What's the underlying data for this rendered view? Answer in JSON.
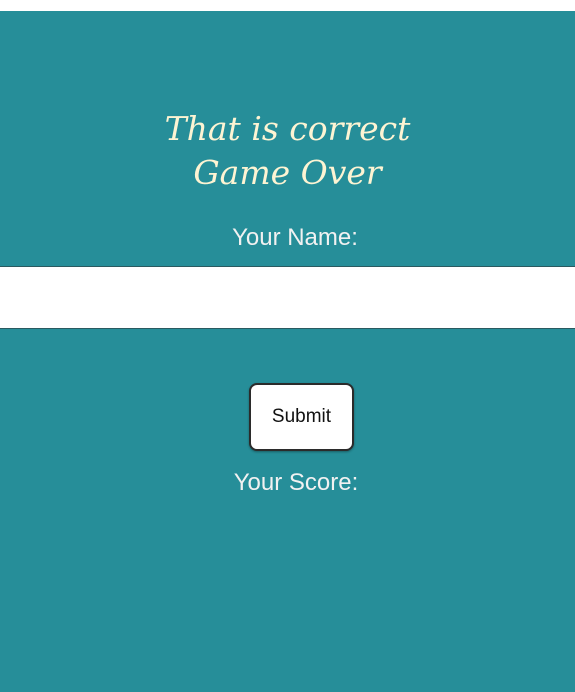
{
  "result": {
    "line1": "That is correct",
    "line2": "Game Over"
  },
  "form": {
    "name_label": "Your Name:",
    "name_value": "",
    "name_placeholder": "",
    "submit_label": "Submit"
  },
  "score": {
    "label": "Your Score:"
  },
  "colors": {
    "panel": "#268e99",
    "heading_text": "#fdf4d3",
    "label_text": "#f1f1f1"
  }
}
